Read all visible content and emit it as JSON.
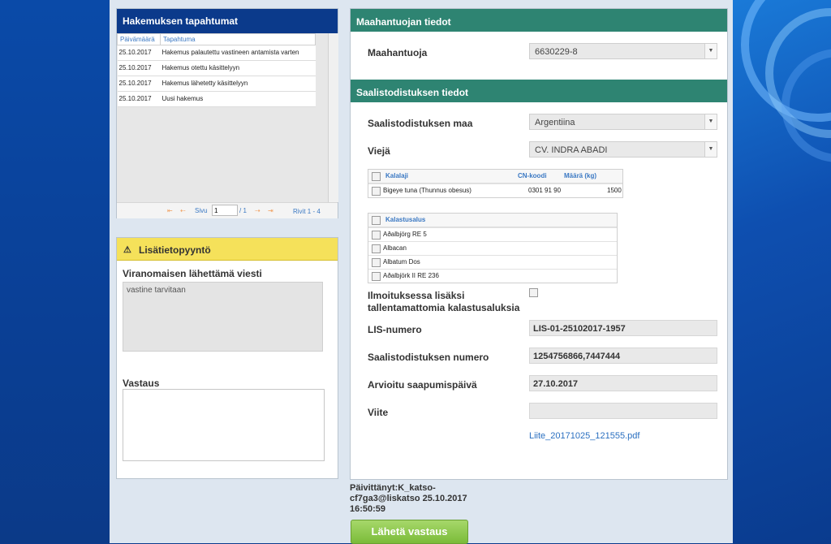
{
  "events": {
    "title": "Hakemuksen tapahtumat",
    "columns": [
      "Päivämäärä",
      "Tapahtuma"
    ],
    "rows": [
      {
        "date": "25.10.2017",
        "event": "Hakemus palautettu vastineen antamista varten"
      },
      {
        "date": "25.10.2017",
        "event": "Hakemus otettu käsittelyyn"
      },
      {
        "date": "25.10.2017",
        "event": "Hakemus lähetetty käsittelyyn"
      },
      {
        "date": "25.10.2017",
        "event": "Uusi hakemus"
      }
    ],
    "pager": {
      "page_label": "Sivu",
      "page_value": "1",
      "page_total": "/ 1",
      "rows_info": "Rivit 1 - 4"
    }
  },
  "info_request": {
    "title": "Lisätietopyyntö",
    "message_label": "Viranomaisen lähettämä viesti",
    "message": "vastine tarvitaan",
    "answer_label": "Vastaus"
  },
  "importer": {
    "section_title": "Maahantuojan tiedot",
    "label": "Maahantuoja",
    "value": "6630229-8"
  },
  "catch_cert": {
    "section_title": "Saalistodistuksen tiedot",
    "country_label": "Saalistodistuksen maa",
    "country_value": "Argentiina",
    "exporter_label": "Viejä",
    "exporter_value": "CV. INDRA ABADI",
    "fish_table": {
      "columns": [
        "Kalalaji",
        "CN-koodi",
        "Määrä (kg)"
      ],
      "rows": [
        {
          "species": "Bigeye tuna (Thunnus obesus)",
          "cn": "0301 91 90",
          "amount": "1500"
        }
      ]
    },
    "vessel_table": {
      "column": "Kalastusalus",
      "rows": [
        "Aðalbjörg RE 5",
        "Albacan",
        "Albatum Dos",
        "Aðalbjörk II RE 236"
      ]
    },
    "unregistered_label_1": "Ilmoituksessa lisäksi",
    "unregistered_label_2": "tallentamattomia kalastusaluksia",
    "lis_label": "LIS-numero",
    "lis_value": "LIS-01-25102017-1957",
    "cert_number_label": "Saalistodistuksen numero",
    "cert_number_value": "1254756866,7447444",
    "arrival_label": "Arvioitu saapumispäivä",
    "arrival_value": "27.10.2017",
    "reference_label": "Viite",
    "reference_value": "",
    "attachment": "Liite_20171025_121555.pdf"
  },
  "footer": {
    "updated_line1": "Päivittänyt:K_katso-",
    "updated_line2": "cf7ga3@liskatso 25.10.2017",
    "updated_line3": "16:50:59",
    "send_label": "Lähetä vastaus"
  }
}
